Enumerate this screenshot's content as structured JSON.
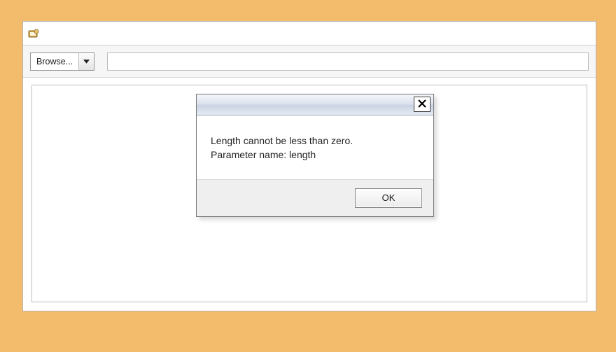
{
  "toolbar": {
    "browse_label": "Browse...",
    "address_value": ""
  },
  "dialog": {
    "message_line1": "Length cannot be less than zero.",
    "message_line2": "Parameter name: length",
    "ok_label": "OK"
  }
}
